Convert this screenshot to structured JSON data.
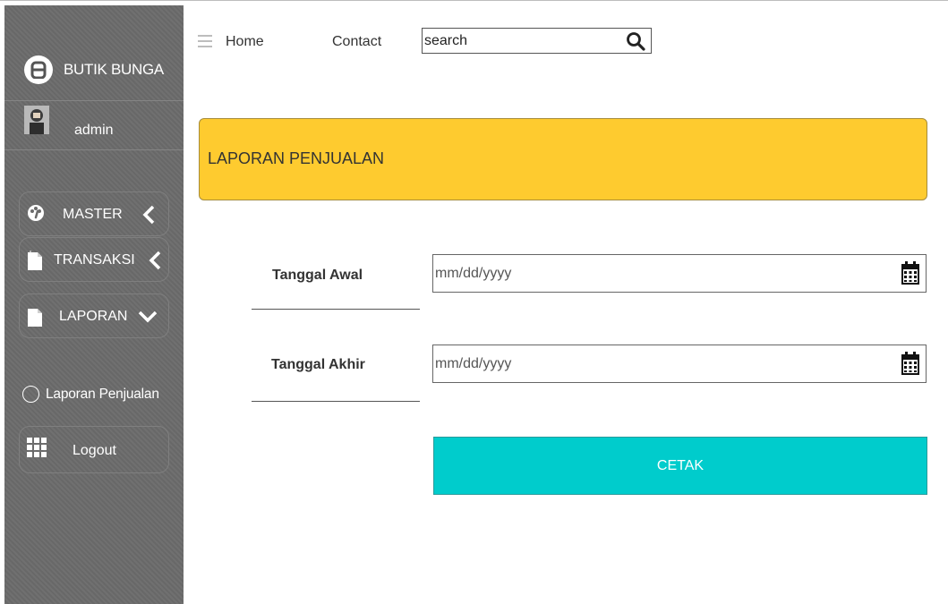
{
  "sidebar": {
    "brand": {
      "name": "BUTIK BUNGA",
      "icon": "brand-logo-icon"
    },
    "user": {
      "name": "admin",
      "icon": "user-avatar"
    },
    "menu": [
      {
        "label": "MASTER",
        "icon": "dashboard-icon",
        "chevron": "chevron-left-icon"
      },
      {
        "label": "TRANSAKSI",
        "icon": "document-icon",
        "chevron": "chevron-left-icon"
      },
      {
        "label": "LAPORAN",
        "icon": "document-icon",
        "chevron": "chevron-down-icon"
      }
    ],
    "submenu": {
      "label": "Laporan Penjualan",
      "icon": "radio-circle-icon"
    },
    "logout": {
      "label": "Logout",
      "icon": "grid-icon"
    }
  },
  "topnav": {
    "menu_icon": "hamburger-icon",
    "home": "Home",
    "contact": "Contact",
    "search": {
      "value": "search",
      "icon": "search-icon"
    }
  },
  "banner": {
    "title": "LAPORAN PENJUALAN"
  },
  "form": {
    "start_date": {
      "label": "Tanggal Awal",
      "placeholder": "mm/dd/yyyy",
      "icon": "calendar-icon"
    },
    "end_date": {
      "label": "Tanggal Akhir",
      "placeholder": "mm/dd/yyyy",
      "icon": "calendar-icon"
    },
    "submit": "CETAK"
  },
  "colors": {
    "sidebar_bg": "#6b6b6b",
    "banner_bg": "#fecb2f",
    "button_bg": "#00cccc",
    "text_light": "#ffffff",
    "text_dark": "#333333"
  }
}
